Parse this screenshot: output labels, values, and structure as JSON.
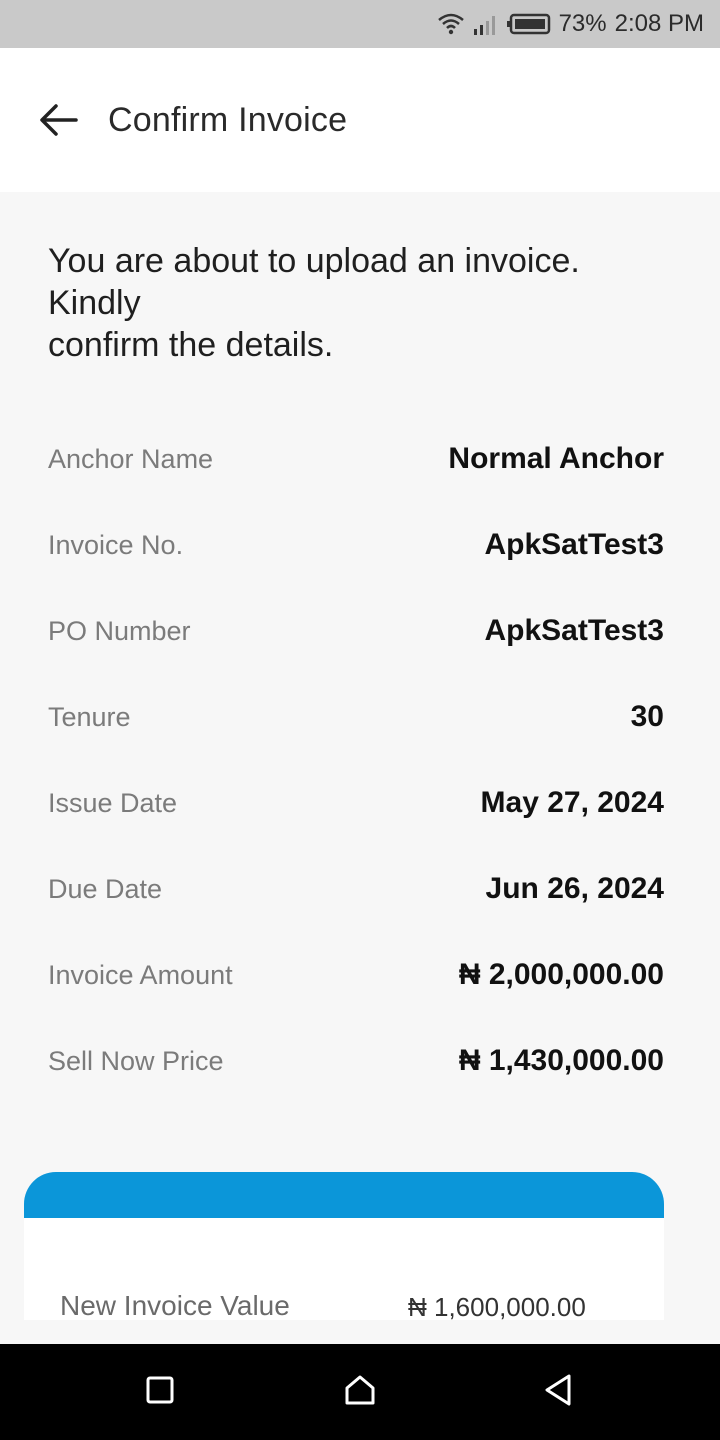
{
  "status_bar": {
    "battery": "73%",
    "time": "2:08 PM"
  },
  "header": {
    "title": "Confirm Invoice"
  },
  "intro": {
    "line1": "You are about to upload an invoice.",
    "line2": "Kindly",
    "line3": "confirm the details."
  },
  "details": [
    {
      "label": "Anchor Name",
      "value": "Normal Anchor"
    },
    {
      "label": "Invoice No.",
      "value": "ApkSatTest3"
    },
    {
      "label": "PO Number",
      "value": "ApkSatTest3"
    },
    {
      "label": "Tenure",
      "value": "30"
    },
    {
      "label": "Issue Date",
      "value": "May 27, 2024"
    },
    {
      "label": "Due Date",
      "value": "Jun 26, 2024"
    },
    {
      "label": "Invoice Amount",
      "value": "₦ 2,000,000.00"
    },
    {
      "label": "Sell Now Price",
      "value": "₦ 1,430,000.00"
    }
  ],
  "summary_card": {
    "label": "New Invoice Value",
    "value": "₦ 1,600,000.00"
  },
  "colors": {
    "accent": "#0b96d9",
    "status_bar": "#c9c9c9"
  }
}
